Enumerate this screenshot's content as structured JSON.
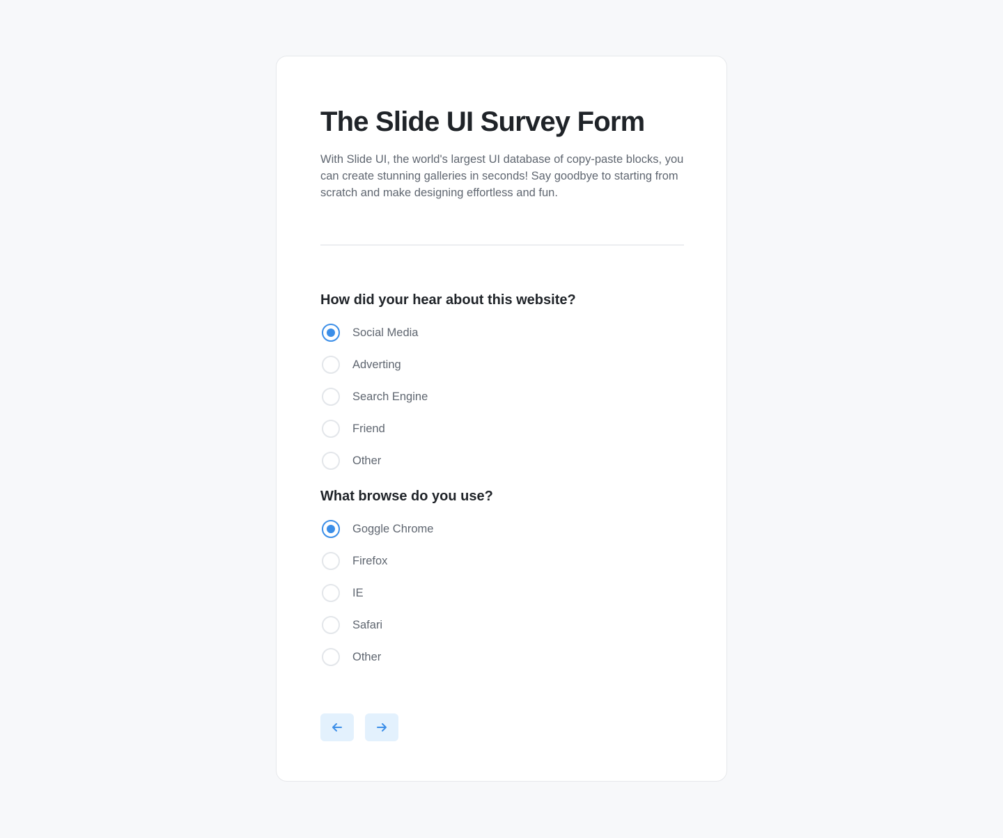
{
  "form": {
    "title": "The Slide UI Survey Form",
    "description": "With Slide UI, the world's largest UI database of copy-paste blocks, you can create stunning galleries in seconds! Say goodbye to starting from scratch and make designing effortless and fun."
  },
  "questions": [
    {
      "label": "How did your hear about this website?",
      "options": [
        "Social Media",
        "Adverting",
        "Search Engine",
        "Friend",
        "Other"
      ],
      "selected": "Social Media"
    },
    {
      "label": "What browse do you use?",
      "options": [
        "Goggle Chrome",
        "Firefox",
        "IE",
        "Safari",
        "Other"
      ],
      "selected": "Goggle Chrome"
    }
  ],
  "nav": {
    "prev_icon": "arrow-left-icon",
    "next_icon": "arrow-right-icon"
  },
  "colors": {
    "accent": "#3b8ee8",
    "nav_button_bg": "#e3f1fd",
    "page_bg": "#f7f8fa"
  }
}
